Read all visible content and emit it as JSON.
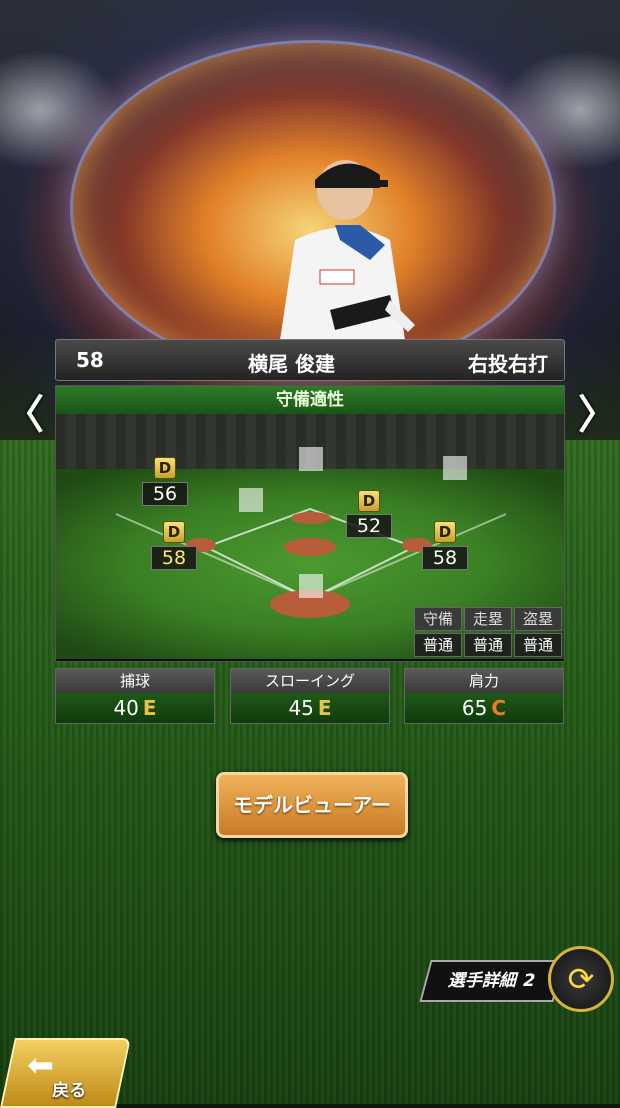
{
  "player": {
    "number": "58",
    "name": "横尾 俊建",
    "hand": "右投右打"
  },
  "defense": {
    "title": "守備適性",
    "positions": [
      {
        "grade": "D",
        "value": "56",
        "yellow": false
      },
      {
        "grade": "D",
        "value": "52",
        "yellow": false
      },
      {
        "grade": "D",
        "value": "58",
        "yellow": true
      },
      {
        "grade": "D",
        "value": "58",
        "yellow": false
      }
    ],
    "mini_stats": [
      {
        "label": "守備",
        "value": "普通"
      },
      {
        "label": "走塁",
        "value": "普通"
      },
      {
        "label": "盗塁",
        "value": "普通"
      }
    ]
  },
  "stats": [
    {
      "label": "捕球",
      "value": "40",
      "grade": "E",
      "grade_color": "#e8c24a"
    },
    {
      "label": "スローイング",
      "value": "45",
      "grade": "E",
      "grade_color": "#e8c24a"
    },
    {
      "label": "肩力",
      "value": "65",
      "grade": "C",
      "grade_color": "#f07a2a"
    }
  ],
  "buttons": {
    "model_viewer": "モデルビューアー",
    "player_detail": "選手詳細 2",
    "back": "戻る",
    "prev": "〈",
    "next": "〉"
  },
  "icons": {
    "cycle": "cycle-icon",
    "back_arrow": "back-arrow-icon"
  }
}
